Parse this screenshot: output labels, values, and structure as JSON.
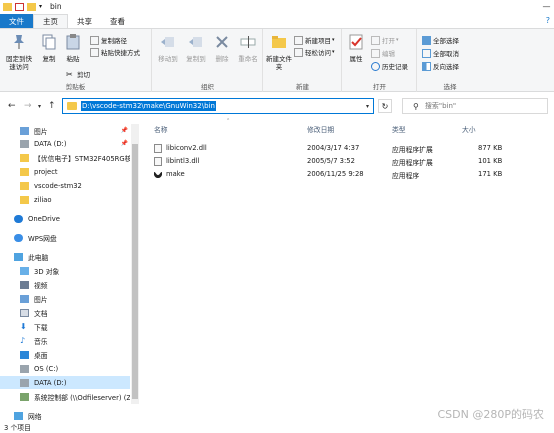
{
  "window": {
    "title": "bin"
  },
  "tabs": [
    {
      "label": "文件"
    },
    {
      "label": "主页"
    },
    {
      "label": "共享"
    },
    {
      "label": "查看"
    }
  ],
  "ribbon": {
    "clipboard": {
      "label": "剪贴板",
      "pin_quick": "固定到快速访问",
      "copy": "复制",
      "paste": "粘贴",
      "copy_path": "复制路径",
      "paste_shortcut": "粘贴快捷方式",
      "cut": "剪切"
    },
    "organize": {
      "label": "组织",
      "move_to": "移动到",
      "copy_to": "复制到",
      "delete": "删除",
      "rename": "重命名"
    },
    "new": {
      "label": "新建",
      "new_folder": "新建文件夹",
      "new_item": "新建项目",
      "easy_access": "轻松访问"
    },
    "open": {
      "label": "打开",
      "properties": "属性",
      "open": "打开",
      "edit": "编辑",
      "history": "历史记录"
    },
    "select": {
      "label": "选择",
      "select_all": "全部选择",
      "select_none": "全部取消",
      "invert": "反向选择"
    }
  },
  "address": {
    "path": "D:\\vscode-stm32\\make\\GnuWin32\\bin"
  },
  "search": {
    "placeholder": "搜索\"bin\""
  },
  "navpane": {
    "items": [
      {
        "label": "图片",
        "icon": "pictures-icon"
      },
      {
        "label": "DATA (D:)",
        "icon": "drive-icon"
      },
      {
        "label": "【优信电子】STM32F405RG核",
        "icon": "folder-icon"
      },
      {
        "label": "project",
        "icon": "folder-icon"
      },
      {
        "label": "vscode-stm32",
        "icon": "folder-icon"
      },
      {
        "label": "ziliao",
        "icon": "folder-icon"
      },
      {
        "label": "OneDrive",
        "icon": "cloud-icon"
      },
      {
        "label": "WPS网盘",
        "icon": "cloud-icon"
      },
      {
        "label": "此电脑",
        "icon": "computer-icon"
      },
      {
        "label": "3D 对象",
        "icon": "3d-objects-icon"
      },
      {
        "label": "视频",
        "icon": "videos-icon"
      },
      {
        "label": "图片",
        "icon": "pictures-icon"
      },
      {
        "label": "文档",
        "icon": "documents-icon"
      },
      {
        "label": "下载",
        "icon": "downloads-icon"
      },
      {
        "label": "音乐",
        "icon": "music-icon"
      },
      {
        "label": "桌面",
        "icon": "desktop-icon"
      },
      {
        "label": "OS (C:)",
        "icon": "drive-icon"
      },
      {
        "label": "DATA (D:)",
        "icon": "drive-icon"
      },
      {
        "label": "系统控制部 (\\\\Odfileserver) (Z",
        "icon": "network-drive-icon"
      },
      {
        "label": "网络",
        "icon": "network-icon"
      }
    ]
  },
  "columns": {
    "name": "名称",
    "date": "修改日期",
    "type": "类型",
    "size": "大小"
  },
  "files": [
    {
      "name": "libiconv2.dll",
      "date": "2004/3/17 4:37",
      "type": "应用程序扩展",
      "size": "877 KB"
    },
    {
      "name": "libintl3.dll",
      "date": "2005/5/7 3:52",
      "type": "应用程序扩展",
      "size": "101 KB"
    },
    {
      "name": "make",
      "date": "2006/11/25 9:28",
      "type": "应用程序",
      "size": "171 KB"
    }
  ],
  "status": {
    "count": "3 个项目"
  },
  "watermark": "CSDN @280P的码农",
  "colors": {
    "accent": "#1979ca",
    "selection": "#cce8ff",
    "address_highlight": "#0078d7"
  }
}
